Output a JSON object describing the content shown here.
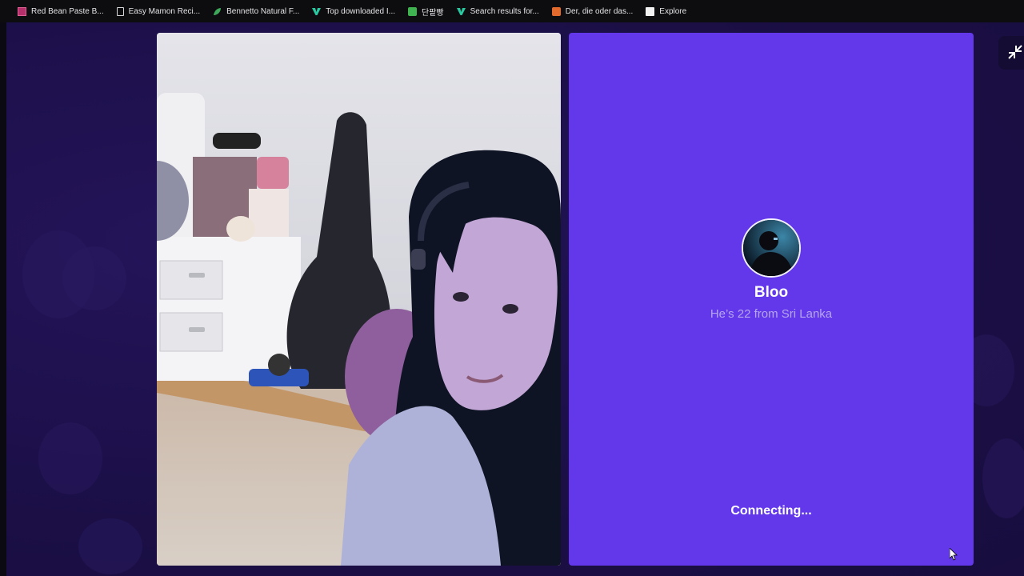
{
  "bookmarks": [
    {
      "label": "Red Bean Paste B...",
      "icon": "grid-favicon"
    },
    {
      "label": "Easy Mamon Reci...",
      "icon": "document-icon"
    },
    {
      "label": "Bennetto Natural F...",
      "icon": "leaf-favicon"
    },
    {
      "label": "Top downloaded I...",
      "icon": "v-favicon"
    },
    {
      "label": "단팥빵",
      "icon": "green-favicon"
    },
    {
      "label": "Search results for...",
      "icon": "v-favicon"
    },
    {
      "label": "Der, die oder das...",
      "icon": "dict-favicon"
    },
    {
      "label": "Explore",
      "icon": "page-favicon"
    }
  ],
  "remote": {
    "name": "Bloo",
    "subtitle": "He’s 22 from Sri Lanka",
    "status": "Connecting..."
  },
  "controls": {
    "exit_fullscreen_icon": "exit-fullscreen-icon"
  },
  "colors": {
    "background": "#1c0f45",
    "remote_panel": "#6238ea",
    "subtitle": "#b6a5ef",
    "bookmarks_bar": "#0d0d0f"
  }
}
